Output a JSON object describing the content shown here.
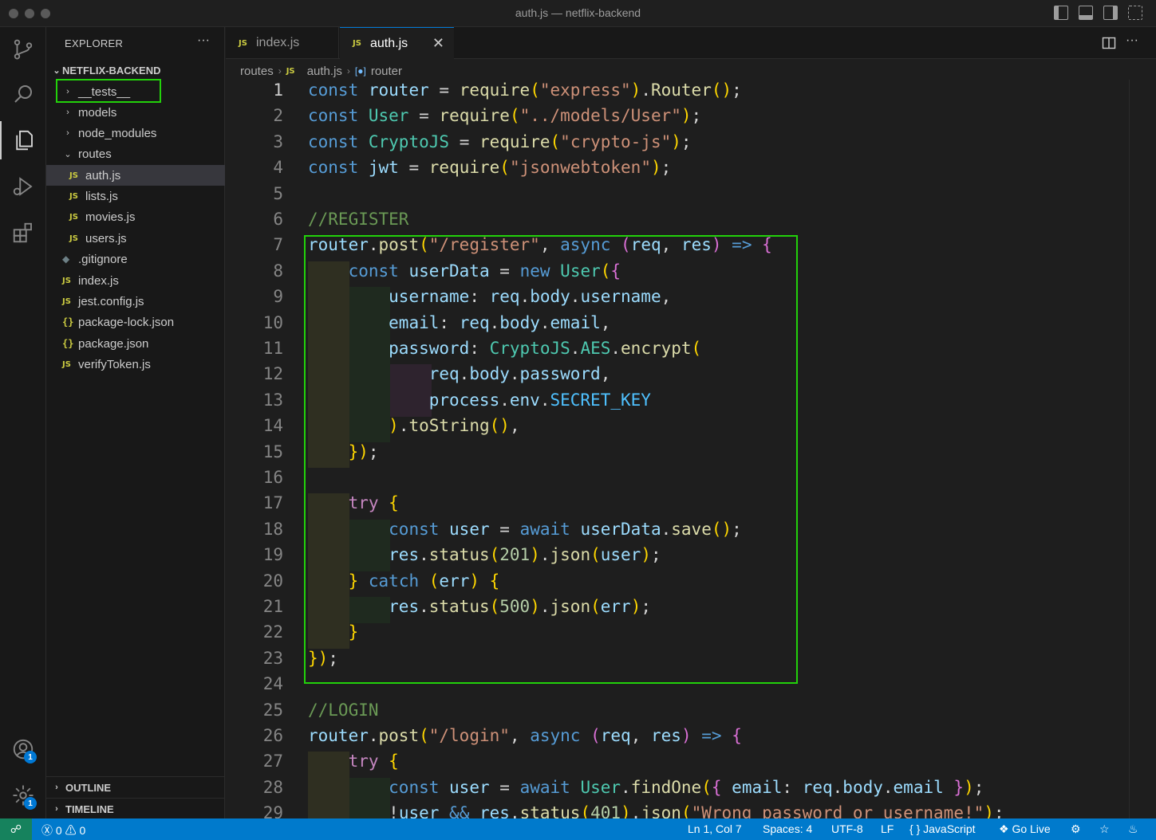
{
  "window": {
    "title": "auth.js — netflix-backend"
  },
  "sidebar": {
    "header": "EXPLORER",
    "root": "NETFLIX-BACKEND",
    "items": [
      {
        "label": "__tests__",
        "kind": "folder",
        "expanded": false
      },
      {
        "label": "models",
        "kind": "folder",
        "expanded": false
      },
      {
        "label": "node_modules",
        "kind": "folder",
        "expanded": false
      },
      {
        "label": "routes",
        "kind": "folder",
        "expanded": true
      },
      {
        "label": "auth.js",
        "kind": "js",
        "selected": true
      },
      {
        "label": "lists.js",
        "kind": "js"
      },
      {
        "label": "movies.js",
        "kind": "js"
      },
      {
        "label": "users.js",
        "kind": "js"
      },
      {
        "label": ".gitignore",
        "kind": "git"
      },
      {
        "label": "index.js",
        "kind": "js"
      },
      {
        "label": "jest.config.js",
        "kind": "js"
      },
      {
        "label": "package-lock.json",
        "kind": "json"
      },
      {
        "label": "package.json",
        "kind": "json"
      },
      {
        "label": "verifyToken.js",
        "kind": "js"
      }
    ],
    "outline": "OUTLINE",
    "timeline": "TIMELINE"
  },
  "tabs": [
    {
      "label": "index.js",
      "active": false
    },
    {
      "label": "auth.js",
      "active": true
    }
  ],
  "breadcrumb": {
    "folder": "routes",
    "file": "auth.js",
    "symbol": "router"
  },
  "editor": {
    "lines": [
      "const router = require(\"express\").Router();",
      "const User = require(\"../models/User\");",
      "const CryptoJS = require(\"crypto-js\");",
      "const jwt = require(\"jsonwebtoken\");",
      "",
      "//REGISTER",
      "router.post(\"/register\", async (req, res) => {",
      "    const userData = new User({",
      "        username: req.body.username,",
      "        email: req.body.email,",
      "        password: CryptoJS.AES.encrypt(",
      "            req.body.password,",
      "            process.env.SECRET_KEY",
      "        ).toString(),",
      "    });",
      "",
      "    try {",
      "        const user = await userData.save();",
      "        res.status(201).json(user);",
      "    } catch (err) {",
      "        res.status(500).json(err);",
      "    }",
      "});",
      "",
      "//LOGIN",
      "router.post(\"/login\", async (req, res) => {",
      "    try {",
      "        const user = await User.findOne({ email: req.body.email });",
      "        !user && res.status(401).json(\"Wrong password or username!\");"
    ]
  },
  "status": {
    "errors": "0",
    "warnings": "0",
    "position": "Ln 1, Col 7",
    "spaces": "Spaces: 4",
    "encoding": "UTF-8",
    "eol": "LF",
    "language": "JavaScript",
    "golive": "Go Live",
    "accounts_badge": "1",
    "settings_badge": "1"
  },
  "colors": {
    "accent": "#007acc",
    "highlight_box": "#22d10a",
    "remote": "#16825d"
  },
  "icons": [
    "source-control-icon",
    "search-icon",
    "explorer-icon",
    "run-debug-icon",
    "extensions-icon",
    "account-icon",
    "settings-gear-icon",
    "split-editor-icon",
    "bell-icon"
  ]
}
